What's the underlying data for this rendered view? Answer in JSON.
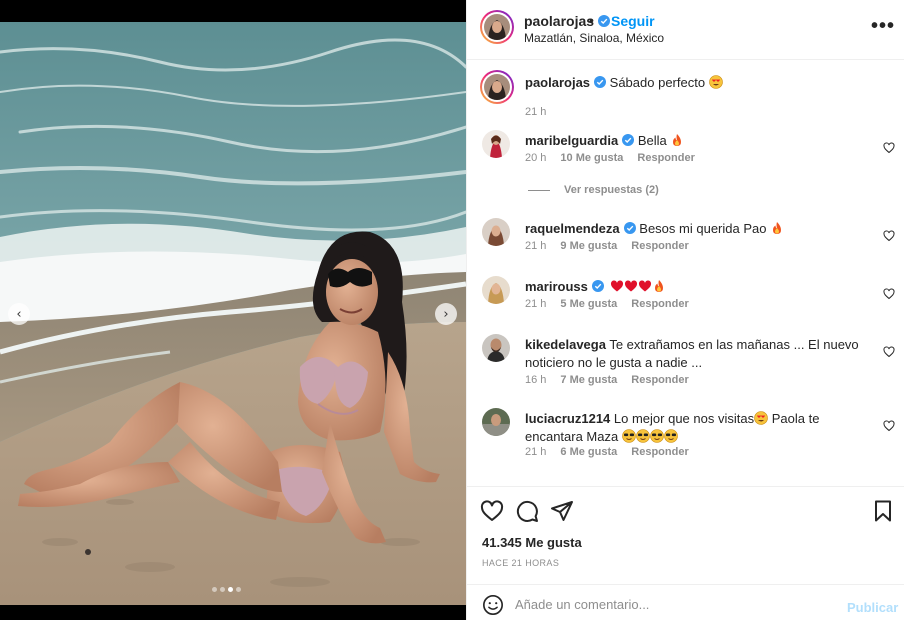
{
  "post": {
    "username": "paolarojas",
    "separator": "•",
    "follow_label": "Seguir",
    "location": "Mazatlán, Sinaloa, México",
    "more_label": "•••"
  },
  "photo": {
    "prev_arrow": "‹",
    "next_arrow": "›",
    "carousel_dots": 4,
    "active_dot": 3
  },
  "caption": {
    "username": "paolarojas",
    "text": "Sábado perfecto",
    "emoji": "heart-eyes-emoji",
    "time": "21 h"
  },
  "comments": [
    {
      "username": "maribelguardia",
      "verified": true,
      "text": "Bella",
      "emoji": "fire-emoji",
      "time": "20 h",
      "likes": "10 Me gusta",
      "reply": "Responder"
    },
    {
      "username": "raquelmendeza",
      "verified": true,
      "text": "Besos mi querida Pao",
      "emoji": "fire-emoji",
      "time": "21 h",
      "likes": "9 Me gusta",
      "reply": "Responder"
    },
    {
      "username": "marirouss",
      "verified": true,
      "text": "",
      "emoji": "red-hearts-fire-emoji",
      "time": "21 h",
      "likes": "5 Me gusta",
      "reply": "Responder"
    },
    {
      "username": "kikedelavega",
      "verified": false,
      "text": "Te extrañamos en las mañanas ... El nuevo noticiero no le gusta a nadie ...",
      "time": "16 h",
      "likes": "7 Me gusta",
      "reply": "Responder"
    },
    {
      "username": "luciacruz1214",
      "verified": false,
      "text": "Lo mejor que nos visitas",
      "text2": "Paola te encantara Maza",
      "emoji": "heart-eyes-and-sunglasses-emoji",
      "time": "21 h",
      "likes": "6 Me gusta",
      "reply": "Responder"
    }
  ],
  "replies_label": "Ver respuestas (2)",
  "actions": {
    "likes": "41.345 Me gusta",
    "time_ago": "HACE 21 HORAS"
  },
  "composer": {
    "placeholder": "Añade un comentario...",
    "publish_label": "Publicar"
  },
  "colors": {
    "link_blue": "#0095f6",
    "publish_disabled": "#b2dffc",
    "muted": "#8e8e8e",
    "text": "#262626",
    "verified_blue": "#3897f0"
  }
}
